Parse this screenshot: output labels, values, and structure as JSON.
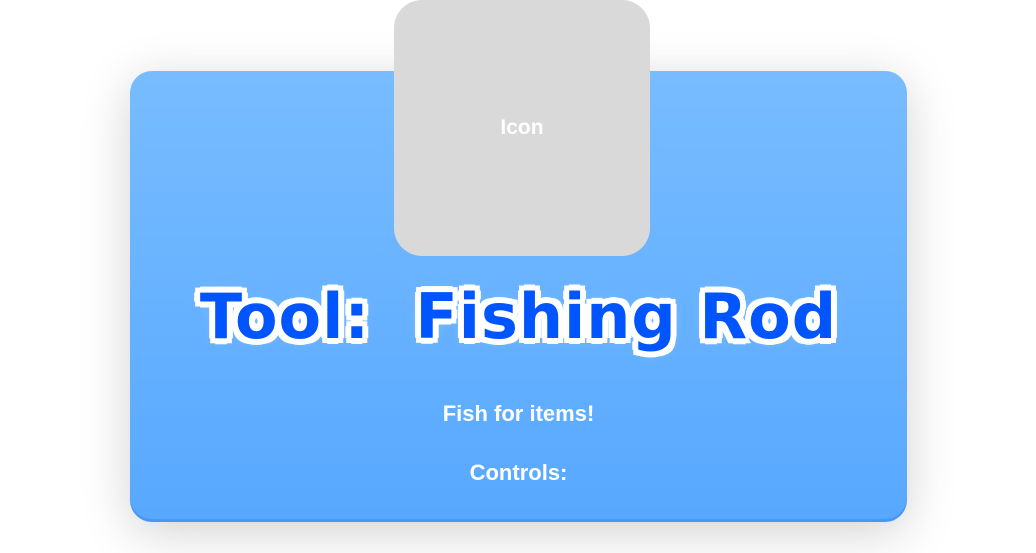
{
  "icon_placeholder": "Icon",
  "title": "Tool:  Fishing Rod",
  "description": "Fish for items!",
  "controls_label": "Controls:",
  "colors": {
    "panel_top": "#78bcff",
    "panel_bottom": "#57a8ff",
    "title": "#0055ff",
    "icon_box": "#d9d9d9"
  }
}
